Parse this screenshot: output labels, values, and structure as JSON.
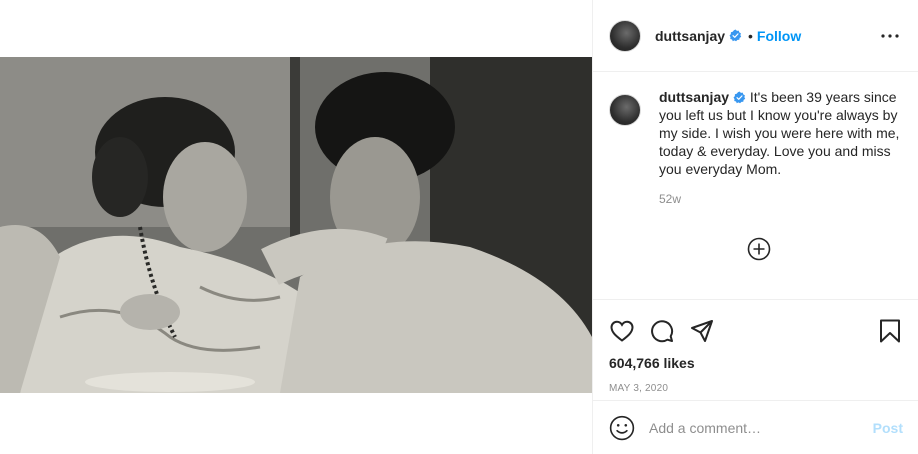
{
  "post": {
    "username": "duttsanjay",
    "separator": "•",
    "follow_label": "Follow",
    "caption": "It's been 39 years since you left us but I know you're always by my side. I wish you were here with me, today & everyday. Love you and miss you everyday Mom.",
    "age": "52w",
    "likes": "604,766 likes",
    "date": "MAY 3, 2020"
  },
  "comment_box": {
    "placeholder": "Add a comment…",
    "post_label": "Post"
  },
  "icons": {
    "verified": "verified-badge-icon",
    "more": "more-options-icon",
    "load_more": "plus-circle-icon",
    "like": "heart-icon",
    "comment": "comment-bubble-icon",
    "share": "paper-plane-icon",
    "save": "bookmark-icon",
    "emoji": "smiley-icon"
  },
  "colors": {
    "link_blue": "#0095f6",
    "post_disabled": "#b2dffc",
    "secondary_text": "#8e8e8e",
    "border": "#efefef"
  }
}
